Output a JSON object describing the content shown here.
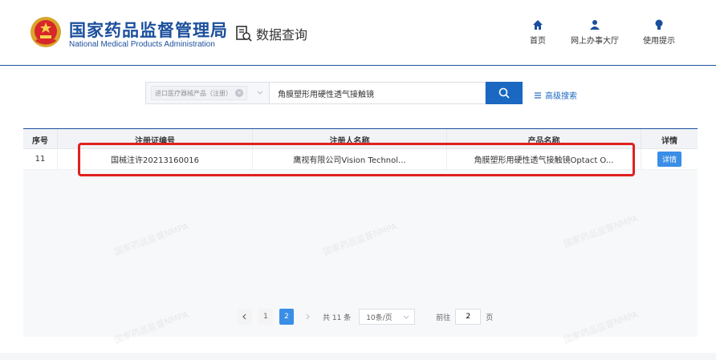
{
  "header": {
    "brand_cn": "国家药品监督管理局",
    "brand_en": "National Medical Products Administration",
    "query_title": "数据查询",
    "nav": [
      {
        "label": "首页",
        "icon": "home-icon"
      },
      {
        "label": "网上办事大厅",
        "icon": "user-icon"
      },
      {
        "label": "使用提示",
        "icon": "bulb-icon"
      }
    ]
  },
  "search": {
    "category_tag": "进口医疗器械产品（注册）",
    "keyword": "角膜塑形用硬性透气接触镜",
    "advanced_label": "高级搜索"
  },
  "table": {
    "headers": [
      "序号",
      "注册证编号",
      "注册人名称",
      "产品名称",
      "详情"
    ],
    "rows": [
      {
        "index": "11",
        "reg_no": "国械注许20213160016",
        "registrant": "鹰视有限公司Vision Technol...",
        "product": "角膜塑形用硬性透气接触镜Optact O...",
        "detail_label": "详情"
      }
    ]
  },
  "watermark": "国家药品监督NMPA",
  "pagination": {
    "pages": [
      "1",
      "2"
    ],
    "current_page": "2",
    "total_text": "共 11 条",
    "page_size": "10条/页",
    "goto_label": "前往",
    "goto_value": "2",
    "page_suffix": "页"
  },
  "colors": {
    "brand_blue": "#1b4f9c",
    "button_blue": "#1a68c1",
    "highlight_red": "#e02020"
  }
}
